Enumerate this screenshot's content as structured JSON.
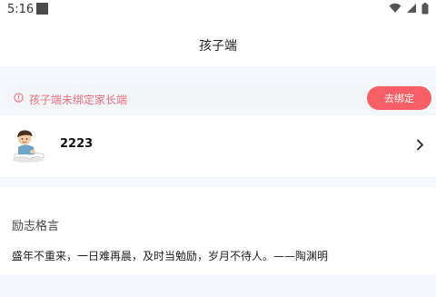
{
  "status_bar": {
    "time": "5:16",
    "icons": [
      "wifi-icon",
      "cellular-signal-icon",
      "battery-icon"
    ]
  },
  "header": {
    "title": "孩子端"
  },
  "bind_banner": {
    "message": "孩子端未绑定家长端",
    "button_label": "去绑定",
    "icon": "alert-circle-icon",
    "accent_color": "#f65f66",
    "text_color": "#e86f7a"
  },
  "account": {
    "name": "2223",
    "avatar_icon": "child-reading-avatar",
    "chevron_icon": "chevron-right-icon"
  },
  "motto": {
    "title": "励志格言",
    "text": "盛年不重来，一日难再晨，及时当勉励，岁月不待人。——陶渊明"
  }
}
